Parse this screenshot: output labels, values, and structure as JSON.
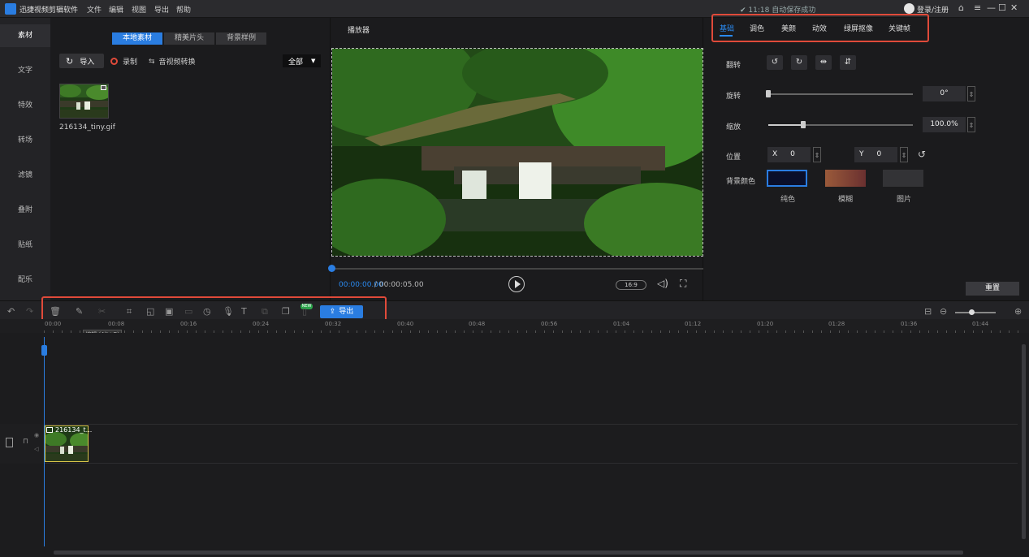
{
  "app": {
    "title": "迅捷视频剪辑软件"
  },
  "menu": [
    "文件",
    "编辑",
    "视图",
    "导出",
    "帮助"
  ],
  "status": {
    "text": "✔ 11:18 自动保存成功"
  },
  "user": {
    "login_label": "登录/注册"
  },
  "window_controls": [
    "⌂",
    "≡",
    "—",
    "☐",
    "✕"
  ],
  "left_rail": [
    "素材",
    "文字",
    "特效",
    "转场",
    "滤镜",
    "叠附",
    "贴纸",
    "配乐"
  ],
  "media": {
    "tabs": [
      "本地素材",
      "精美片头",
      "背景样例"
    ],
    "import_label": "导入",
    "record_label": "录制",
    "convert_label": "音视频转换",
    "filter_value": "全部",
    "file_name": "216134_tiny.gif"
  },
  "player": {
    "title": "播放器",
    "time_current": "00:00:00.00",
    "time_total": "/ 00:00:05.00",
    "ratio": "16:9",
    "progress": 0
  },
  "props": {
    "tabs": [
      "基础",
      "调色",
      "美颜",
      "动效",
      "绿屏抠像",
      "关键帧"
    ],
    "flip_label": "翻转",
    "rotate_label": "旋转",
    "rotate_value": "0°",
    "scale_label": "缩放",
    "scale_value": "100.0%",
    "position_label": "位置",
    "pos_x_label": "X",
    "pos_x_value": "0",
    "pos_y_label": "Y",
    "pos_y_value": "0",
    "bg_label": "背景颜色",
    "bg_options": [
      "纯色",
      "模糊",
      "图片"
    ],
    "reset_label": "重置",
    "colors": {
      "solid": "#0a0f2a",
      "blur_from": "#8a4a2e",
      "blur_to": "#5a2a2a",
      "image": "#333336"
    }
  },
  "toolbar": {
    "export_label": "导出",
    "new_badge": "NEW",
    "tooltip": "编辑 (Alt+E)"
  },
  "ruler": [
    "00:00",
    "00:08",
    "00:16",
    "00:24",
    "00:32",
    "00:40",
    "00:48",
    "00:56",
    "01:04",
    "01:12",
    "01:20",
    "01:28",
    "01:36",
    "01:44"
  ],
  "clip": {
    "label": "216134_t..."
  },
  "accent": "#2a7de1",
  "highlight": "#e04a3a"
}
